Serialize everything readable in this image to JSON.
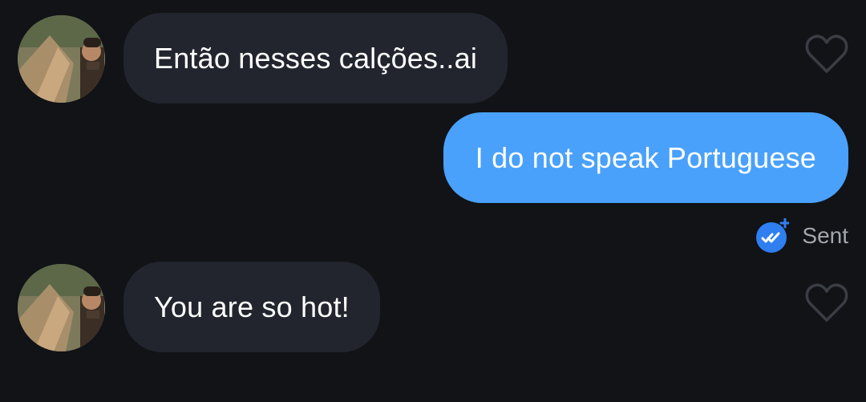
{
  "conversation": {
    "messages": [
      {
        "direction": "incoming",
        "text": "Então nesses calções..ai"
      },
      {
        "direction": "outgoing",
        "text": "I do not speak Portuguese"
      },
      {
        "direction": "incoming",
        "text": "You are so hot!"
      }
    ],
    "status": {
      "text": "Sent",
      "icon": "double-check-icon"
    }
  },
  "colors": {
    "background": "#111317",
    "incoming_bubble": "#22252d",
    "outgoing_bubble": "#4aa1fb",
    "status_text": "#a3a6ad",
    "sent_badge": "#2f7ff0"
  }
}
